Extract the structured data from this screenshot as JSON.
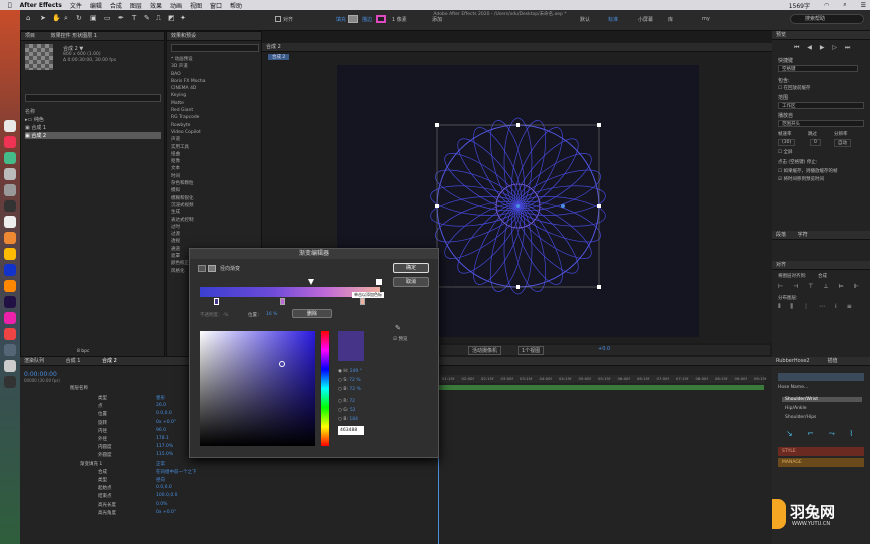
{
  "menubar": {
    "app": "After Effects",
    "items": [
      "文件",
      "编辑",
      "合成",
      "图层",
      "效果",
      "动画",
      "视图",
      "窗口",
      "帮助"
    ],
    "status": "1569字",
    "search": "搜索帮助"
  },
  "window_title": "Adobe After Effects 2020 - /Users/xdu/Desktop/未命名.aep *",
  "toolbar": {
    "align": "对齐",
    "fill": "填充",
    "stroke": "描边",
    "stroke_px": "1 像素",
    "add": "添加",
    "default": "默认",
    "standard": "标准",
    "small": "小屏幕",
    "library": "库",
    "my": "my",
    "search": "搜索帮助"
  },
  "project": {
    "tab": "项目",
    "effects_tab": "效果控件 形状图层 1",
    "comp_name": "合成 2 ▼",
    "info1": "800 x 600 (1.00)",
    "info2": "Δ 0:00:30:00, 30.00 fps",
    "col_name": "名称",
    "items": [
      {
        "name": "纯色"
      },
      {
        "name": "合成 1"
      },
      {
        "name": "合成 2"
      }
    ],
    "bpc": "8 bpc"
  },
  "effects": {
    "tab": "效果和预设",
    "items": [
      "* 动画预设",
      "3D 声道",
      "BAO",
      "Boris FX Mocha",
      "CINEMA 4D",
      "Keying",
      "Matte",
      "Red Giant",
      "RG Trapcode",
      "Rowbyte",
      "Video Copilot",
      "声道",
      "实用工具",
      "扭曲",
      "抠像",
      "文本",
      "时间",
      "杂色和颗粒",
      "模拟",
      "模糊和锐化",
      "沉浸式视频",
      "生成",
      "表达式控制",
      "过时",
      "过渡",
      "透视",
      "通道",
      "遮罩",
      "颜色校正",
      "风格化"
    ]
  },
  "comp": {
    "tab": "合成 2",
    "breadcrumb": "合成 2",
    "zoom": "",
    "camera": "活动摄像机",
    "views": "1个视图",
    "exposure": "+0.0"
  },
  "gradient_editor": {
    "title": "渐变编辑器",
    "type": "径向渐变",
    "ok": "确定",
    "cancel": "取消",
    "opacity_label": "不透明度：-%",
    "position_label": "位置：",
    "position_value": "16 %",
    "delete": "删除",
    "tooltip": "单击以添加色标",
    "hue_label": "H:",
    "hue": "249 °",
    "s_label": "S:",
    "s": "72 %",
    "b_label": "B:",
    "b": "72 %",
    "r_label": "R:",
    "r": "72",
    "g_label": "G:",
    "g": "52",
    "bb_label": "B:",
    "bb": "184",
    "hex": "463488",
    "preview": "预览"
  },
  "timeline": {
    "tab_render": "渲染队列",
    "tab1": "合成 1",
    "tab2": "合成 2",
    "time": "0:00:00:00",
    "frames": "00000 (30.00 fps)",
    "col_label": "图层名称",
    "props": [
      {
        "name": "类型",
        "value": "星形"
      },
      {
        "name": "点",
        "value": "26.0"
      },
      {
        "name": "位置",
        "value": "0.0,0.0"
      },
      {
        "name": "旋转",
        "value": "0x +0.0°"
      },
      {
        "name": "内径",
        "value": "96.0"
      },
      {
        "name": "外径",
        "value": "178.1"
      },
      {
        "name": "内圆度",
        "value": "117.0%"
      },
      {
        "name": "外圆度",
        "value": "115.0%"
      },
      {
        "name": "渐变填充 1",
        "value": "正常"
      },
      {
        "name": "合成",
        "value": "在同组中前一个之下"
      },
      {
        "name": "类型",
        "value": "径向"
      },
      {
        "name": "起始点",
        "value": "0.0,0.0"
      },
      {
        "name": "结束点",
        "value": "100.0,0.0"
      },
      {
        "name": "高光长度",
        "value": "0.0%"
      },
      {
        "name": "高光角度",
        "value": "0x +0.0°"
      }
    ],
    "ruler": [
      "01:15f",
      "02:00f",
      "02:15f",
      "03:00f",
      "03:15f",
      "04:00f",
      "04:15f",
      "05:00f",
      "05:15f",
      "06:00f",
      "06:15f",
      "07:00f",
      "07:15f",
      "08:00f",
      "08:15f",
      "09:00f",
      "09:15f"
    ]
  },
  "preview": {
    "title": "预览",
    "shortcut_label": "快捷键",
    "shortcut": "空格键",
    "include": "包含:",
    "cache": "在回放前缓存",
    "range_label": "范围",
    "range": "工作区",
    "play_from_label": "播放自",
    "play_from": "范围开头",
    "fps_label": "帧速率",
    "skip_label": "跳过",
    "res_label": "分辨率",
    "fps": "(30)",
    "skip": "0",
    "res": "自动",
    "fullscreen": "全屏",
    "stop_label": "点击 (空格键) 停止:",
    "opt1": "如果缓存，则播放缓存的帧",
    "opt2": "将时间移到预览时间"
  },
  "right_tabs": {
    "para": "段落",
    "char": "字符",
    "align": "对齐",
    "align_to": "将图层对齐到:",
    "align_target": "合成",
    "distribute": "分布图层:"
  },
  "rubberhose": {
    "tab1": "RubberHose2",
    "tab2": "插值",
    "hose_name": "Hose Name...",
    "list": [
      "Shoulder/Wrist",
      "Hip/Ankle",
      "Shoulder/Hips"
    ],
    "style": "STYLE",
    "manage": "MANAGE"
  },
  "watermark": {
    "brand": "羽兔网",
    "url": "WWW.YUTU.CN"
  },
  "colors": {
    "accent": "#4a8fe0",
    "grad_start": "#3b3fd0",
    "grad_end": "#f0b0a0",
    "swatch": "#463488"
  }
}
